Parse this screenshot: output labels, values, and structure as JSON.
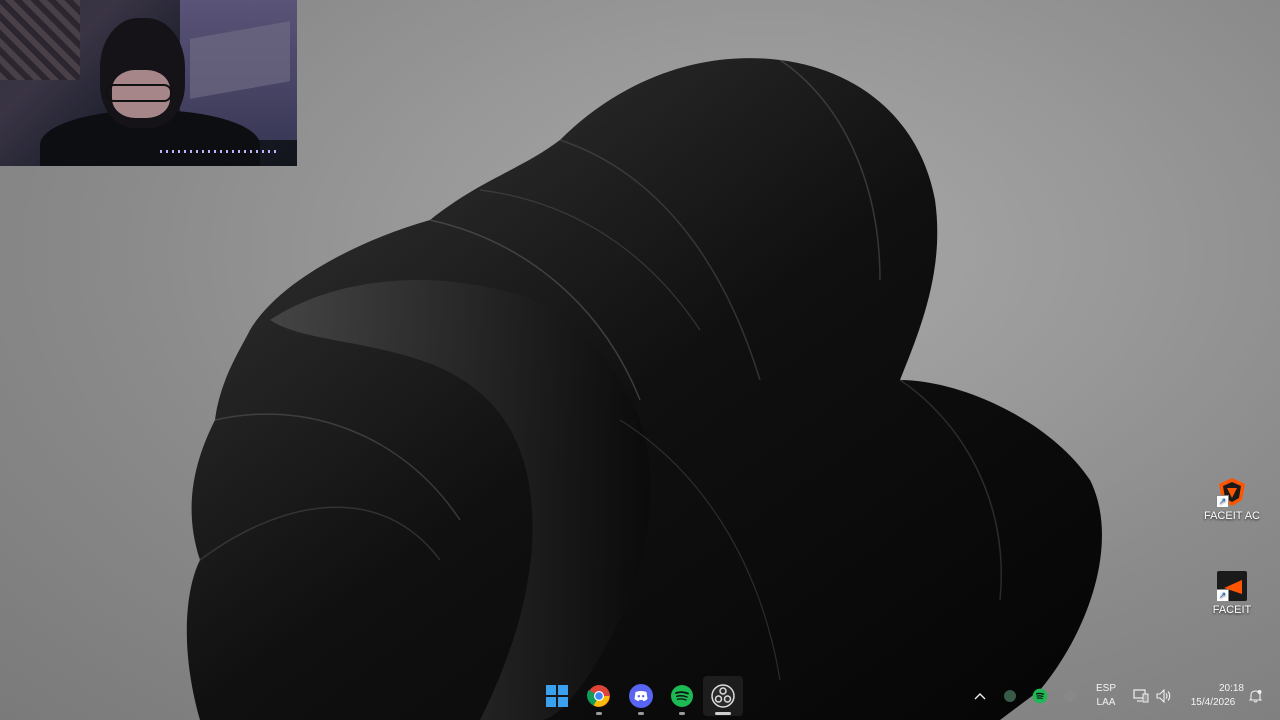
{
  "desktop": {
    "icons": [
      {
        "label": "FACEIT AC",
        "icon": "faceit-ac-icon"
      },
      {
        "label": "FACEIT",
        "icon": "faceit-icon"
      }
    ]
  },
  "webcam": {
    "icon": "webcam-overlay"
  },
  "taskbar": {
    "apps": [
      {
        "name": "Start",
        "icon": "windows-start-icon"
      },
      {
        "name": "Google Chrome",
        "icon": "chrome-icon"
      },
      {
        "name": "Discord",
        "icon": "discord-icon"
      },
      {
        "name": "Spotify",
        "icon": "spotify-icon"
      },
      {
        "name": "OBS Studio",
        "icon": "obs-icon"
      }
    ],
    "tray": {
      "overflow_icon": "chevron-up-icon",
      "language": {
        "line1": "ESP",
        "line2": "LAA"
      },
      "clock": {
        "time": "20:18",
        "date": "15/4/2026"
      },
      "network_icon": "network-icon",
      "volume_icon": "volume-icon",
      "notification_icon": "notification-icon"
    }
  },
  "colors": {
    "spotify": "#1db954",
    "discord": "#5865f2",
    "windows_blue": "#3aa0f0",
    "faceit_orange": "#ff5500"
  }
}
